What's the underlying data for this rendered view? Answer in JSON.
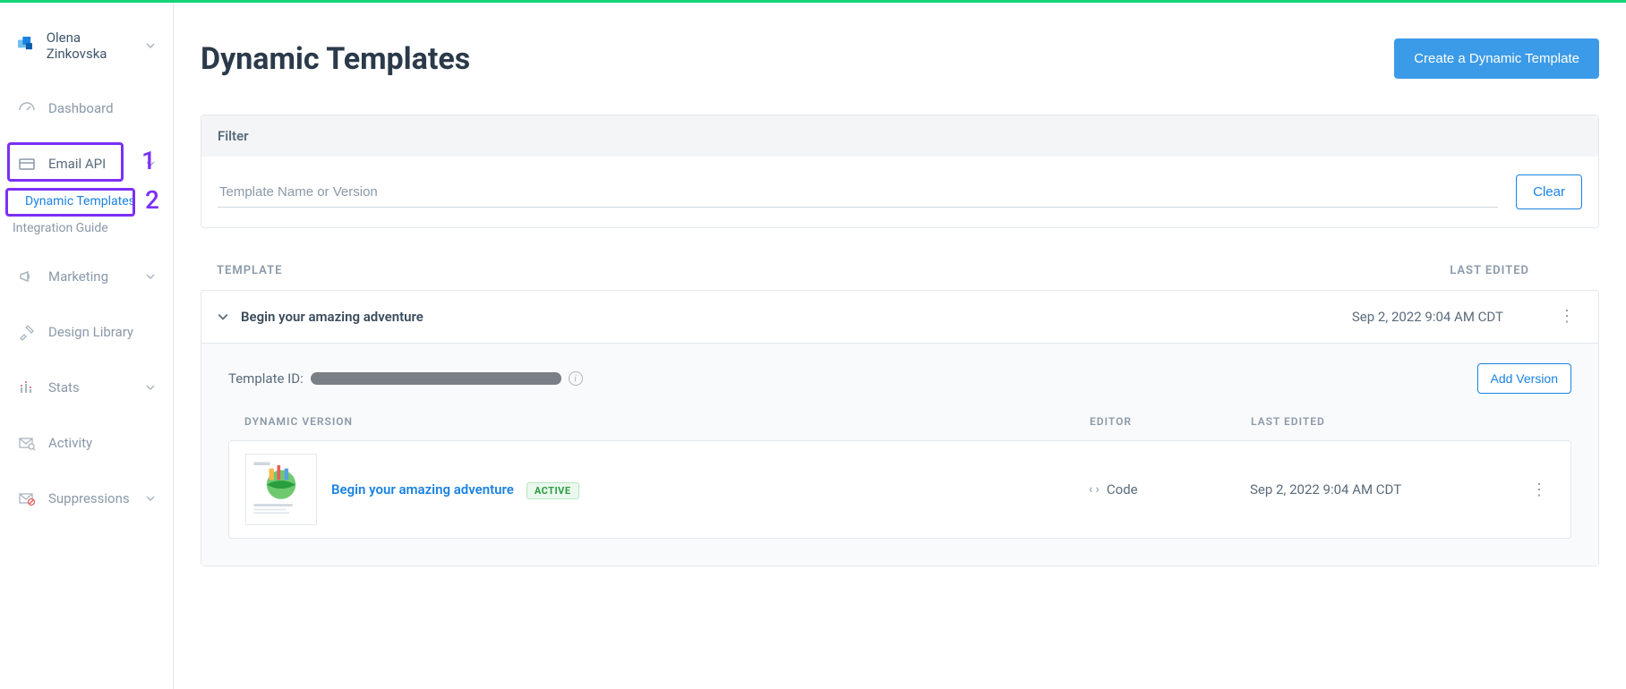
{
  "user": {
    "name": "Olena Zinkovska"
  },
  "nav": {
    "dashboard": "Dashboard",
    "emailapi": "Email API",
    "dynamic_templates": "Dynamic Templates",
    "integration_guide": "Integration Guide",
    "marketing": "Marketing",
    "design_library": "Design Library",
    "stats": "Stats",
    "activity": "Activity",
    "suppressions": "Suppressions"
  },
  "annotations": {
    "one": "1",
    "two": "2"
  },
  "page": {
    "title": "Dynamic Templates",
    "create_btn": "Create a Dynamic Template"
  },
  "filter": {
    "heading": "Filter",
    "placeholder": "Template Name or Version",
    "clear": "Clear"
  },
  "list": {
    "col_template": "TEMPLATE",
    "col_last_edited": "LAST EDITED"
  },
  "template": {
    "name": "Begin your amazing adventure",
    "last_edited": "Sep 2, 2022 9:04 AM CDT",
    "id_label": "Template ID:",
    "add_version": "Add Version",
    "ver_cols": {
      "dynamic_version": "DYNAMIC VERSION",
      "editor": "EDITOR",
      "last_edited": "LAST EDITED"
    },
    "version": {
      "name": "Begin your amazing adventure",
      "badge": "ACTIVE",
      "editor": "Code",
      "last_edited": "Sep 2, 2022 9:04 AM CDT"
    }
  }
}
